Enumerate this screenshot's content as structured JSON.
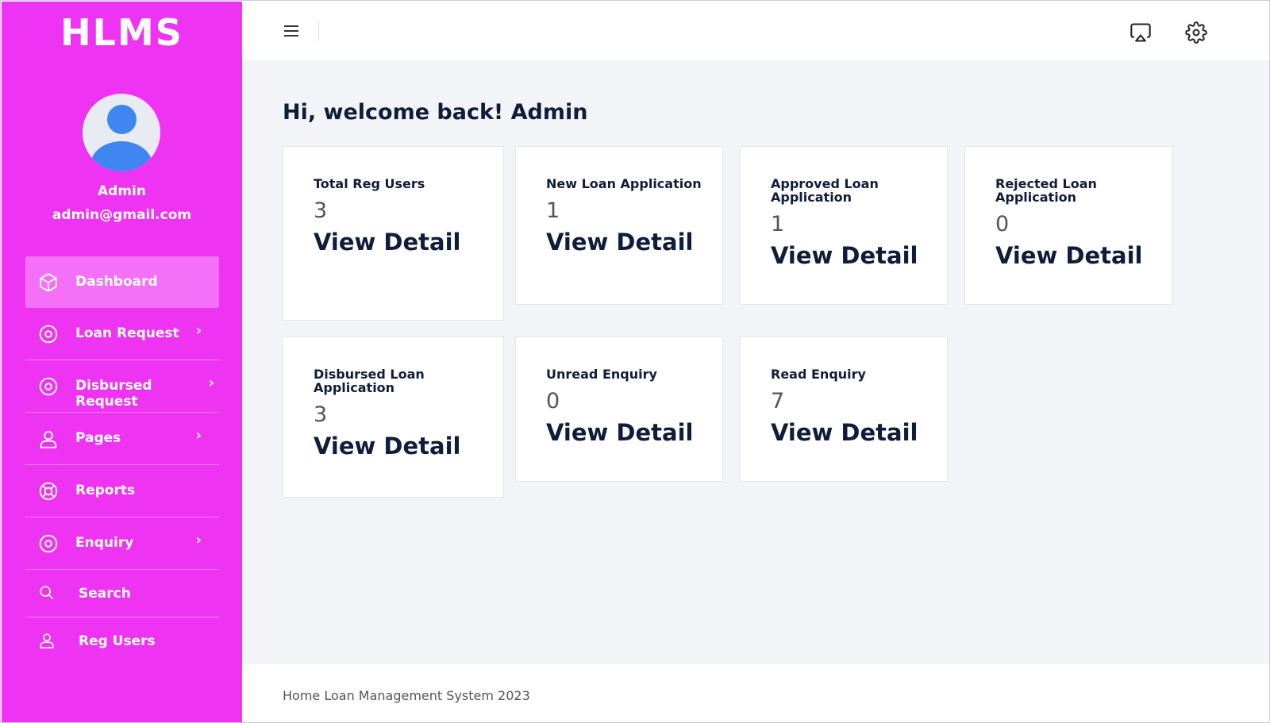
{
  "sidebar": {
    "brand": "HLMS",
    "user": {
      "name": "Admin",
      "email": "admin@gmail.com"
    },
    "items": [
      {
        "label": "Dashboard",
        "icon": "box-icon",
        "active": true,
        "has_chevron": false
      },
      {
        "label": "Loan Request",
        "icon": "target-icon",
        "has_chevron": true
      },
      {
        "label": "Disbursed Request",
        "icon": "target-icon",
        "has_chevron": true
      },
      {
        "label": "Pages",
        "icon": "user-icon",
        "has_chevron": true
      },
      {
        "label": "Reports",
        "icon": "lifebuoy-icon",
        "has_chevron": false
      },
      {
        "label": "Enquiry",
        "icon": "target-icon",
        "has_chevron": true
      },
      {
        "label": "Search",
        "icon": "search-icon",
        "has_chevron": false
      },
      {
        "label": "Reg Users",
        "icon": "user-icon",
        "has_chevron": false
      }
    ]
  },
  "topbar": {
    "icons": [
      "menu-icon",
      "airplay-icon",
      "gear-icon"
    ]
  },
  "main": {
    "welcome": "Hi, welcome back! Admin",
    "cards": [
      {
        "title": "Total Reg Users",
        "value": "3",
        "link": "View Detail"
      },
      {
        "title": "New Loan Application",
        "value": "1",
        "link": "View Detail"
      },
      {
        "title": "Approved Loan Application",
        "value": "1",
        "link": "View Detail"
      },
      {
        "title": "Rejected Loan Application",
        "value": "0",
        "link": "View Detail"
      },
      {
        "title": "Disbursed Loan Application",
        "value": "3",
        "link": "View Detail"
      },
      {
        "title": "Unread Enquiry",
        "value": "0",
        "link": "View Detail"
      },
      {
        "title": "Read Enquiry",
        "value": "7",
        "link": "View Detail"
      }
    ]
  },
  "footer": {
    "text": "Home Loan Management System 2023"
  },
  "colors": {
    "sidebar": "#ef33f3",
    "avatar": "#3f86f0",
    "background": "#f2f4f8",
    "text": "#0f1d3a"
  }
}
